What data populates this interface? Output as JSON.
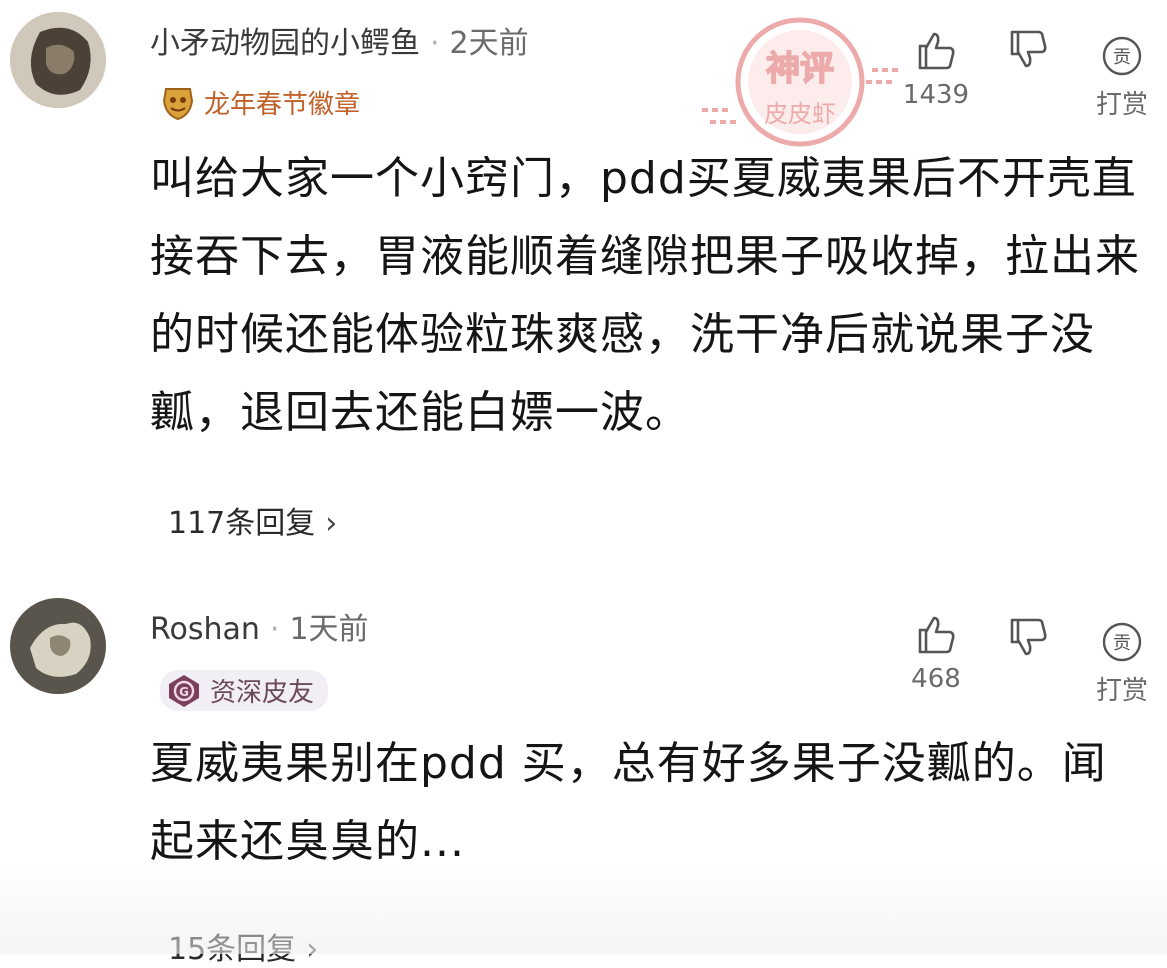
{
  "comments": [
    {
      "username": "小矛动物园的小鳄鱼",
      "time": "2天前",
      "badge": "龙年春节徽章",
      "content": "叫给大家一个小窍门，pdd买夏威夷果后不开壳直接吞下去，胃液能顺着缝隙把果子吸收掉，拉出来的时候还能体验粒珠爽感，洗干净后就说果子没瓤，退回去还能白嫖一波。",
      "like_count": "1439",
      "tip_label": "打赏",
      "replies": "117条回复"
    },
    {
      "username": "Roshan",
      "time": "1天前",
      "badge": "资深皮友",
      "content": "夏威夷果别在pdd 买，总有好多果子没瓤的。闻起来还臭臭的...",
      "like_count": "468",
      "tip_label": "打赏",
      "replies": "15条回复"
    }
  ],
  "watermark": {
    "top_text": "神评",
    "bottom_text": "皮皮虾",
    "color": "#e06666"
  },
  "icons": {
    "like": "thumbs-up-icon",
    "dislike": "thumbs-down-icon",
    "tip": "tip-coin-icon",
    "chevron": "chevron-right-icon"
  }
}
